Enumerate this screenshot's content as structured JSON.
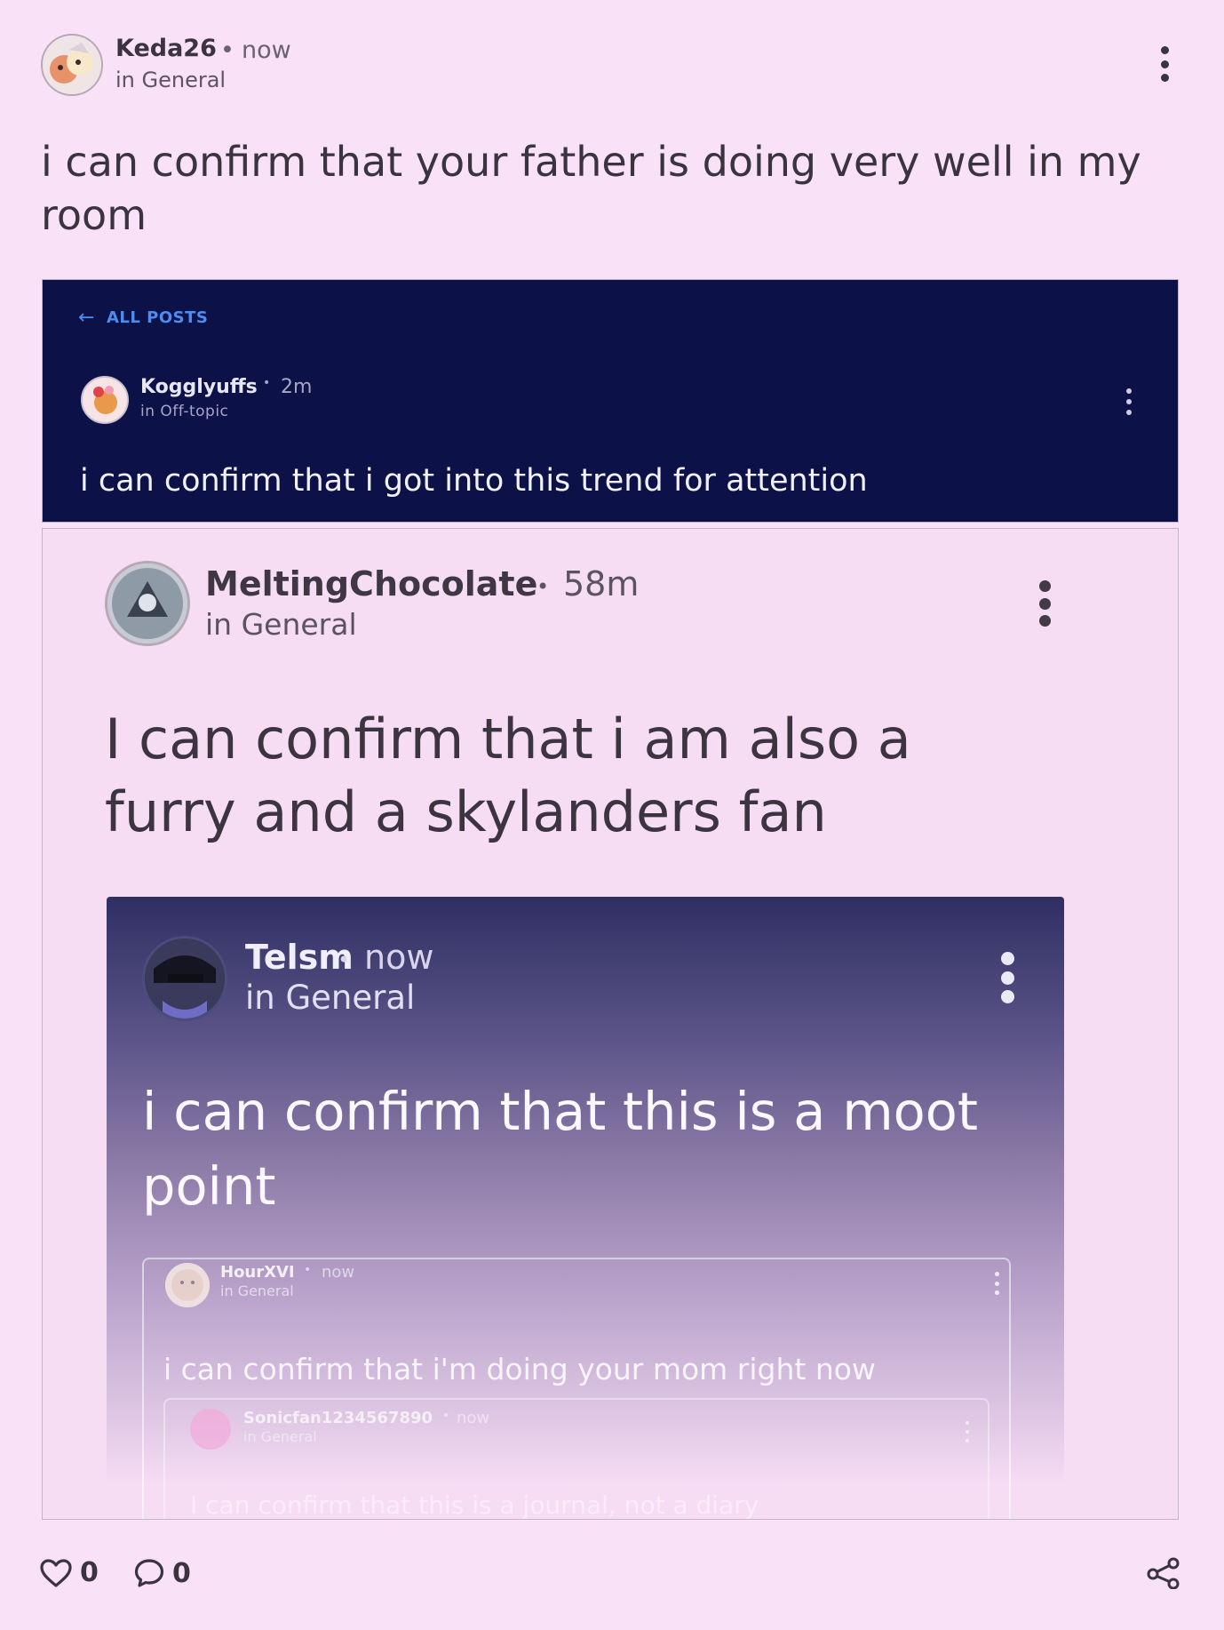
{
  "post": {
    "username": "Keda26",
    "separator": "•",
    "time": "now",
    "channel": "in General",
    "body": "i can confirm that your father is doing very well in my room"
  },
  "quote1": {
    "back_label": "ALL POSTS",
    "username": "Kogglyuffs",
    "separator": "•",
    "time": "2m",
    "channel": "in Off-topic",
    "body": "i can confirm that i got into this trend for attention"
  },
  "quote2": {
    "username": "MeltingChocolate",
    "separator": "•",
    "time": "58m",
    "channel": "in General",
    "body": "I can confirm that i am also a furry and a skylanders fan"
  },
  "quote3": {
    "username": "Telsm",
    "separator": "•",
    "time": "now",
    "channel": "in General",
    "body": "i can confirm that this is a moot point"
  },
  "quote4": {
    "username": "HourXVI",
    "separator": "•",
    "time": "now",
    "channel": "in General",
    "body": "i can confirm that i'm doing your mom right now"
  },
  "quote5": {
    "username": "Sonicfan1234567890",
    "separator": "•",
    "time": "now",
    "channel": "in General",
    "body": "I can confirm that this is a journal, not a diary"
  },
  "footer": {
    "likes": "0",
    "comments": "0"
  },
  "icons": {
    "like": "heart-icon",
    "comment": "comment-bubble-icon",
    "share": "share-icon",
    "menu": "more-vertical-icon",
    "back": "arrow-left-icon"
  },
  "colors": {
    "background": "#f9e1f8",
    "dark_panel": "#0c1148",
    "link_blue": "#4d8df0"
  }
}
